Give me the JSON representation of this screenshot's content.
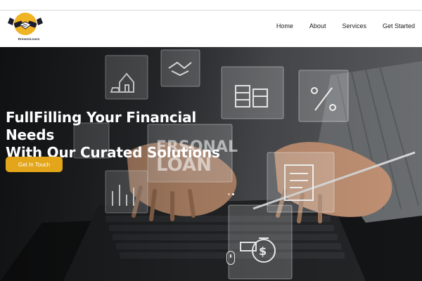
{
  "brand": {
    "name": "DreamsLoans"
  },
  "nav": {
    "items": [
      {
        "label": "Home"
      },
      {
        "label": "About"
      },
      {
        "label": "Services"
      },
      {
        "label": "Get Started"
      }
    ]
  },
  "hero": {
    "title_line1": "FullFilling Your Financial Needs",
    "title_line2": "With Our Curated Solutions",
    "cta_label": "Get In Touch",
    "background_text_line1": "ERSONAL",
    "background_text_line2": "LOAN",
    "slides": {
      "count": 2,
      "active_index": 1
    }
  },
  "colors": {
    "accent": "#e3a51a",
    "text_dark": "#1a1a1a",
    "hero_text": "#ffffff"
  }
}
